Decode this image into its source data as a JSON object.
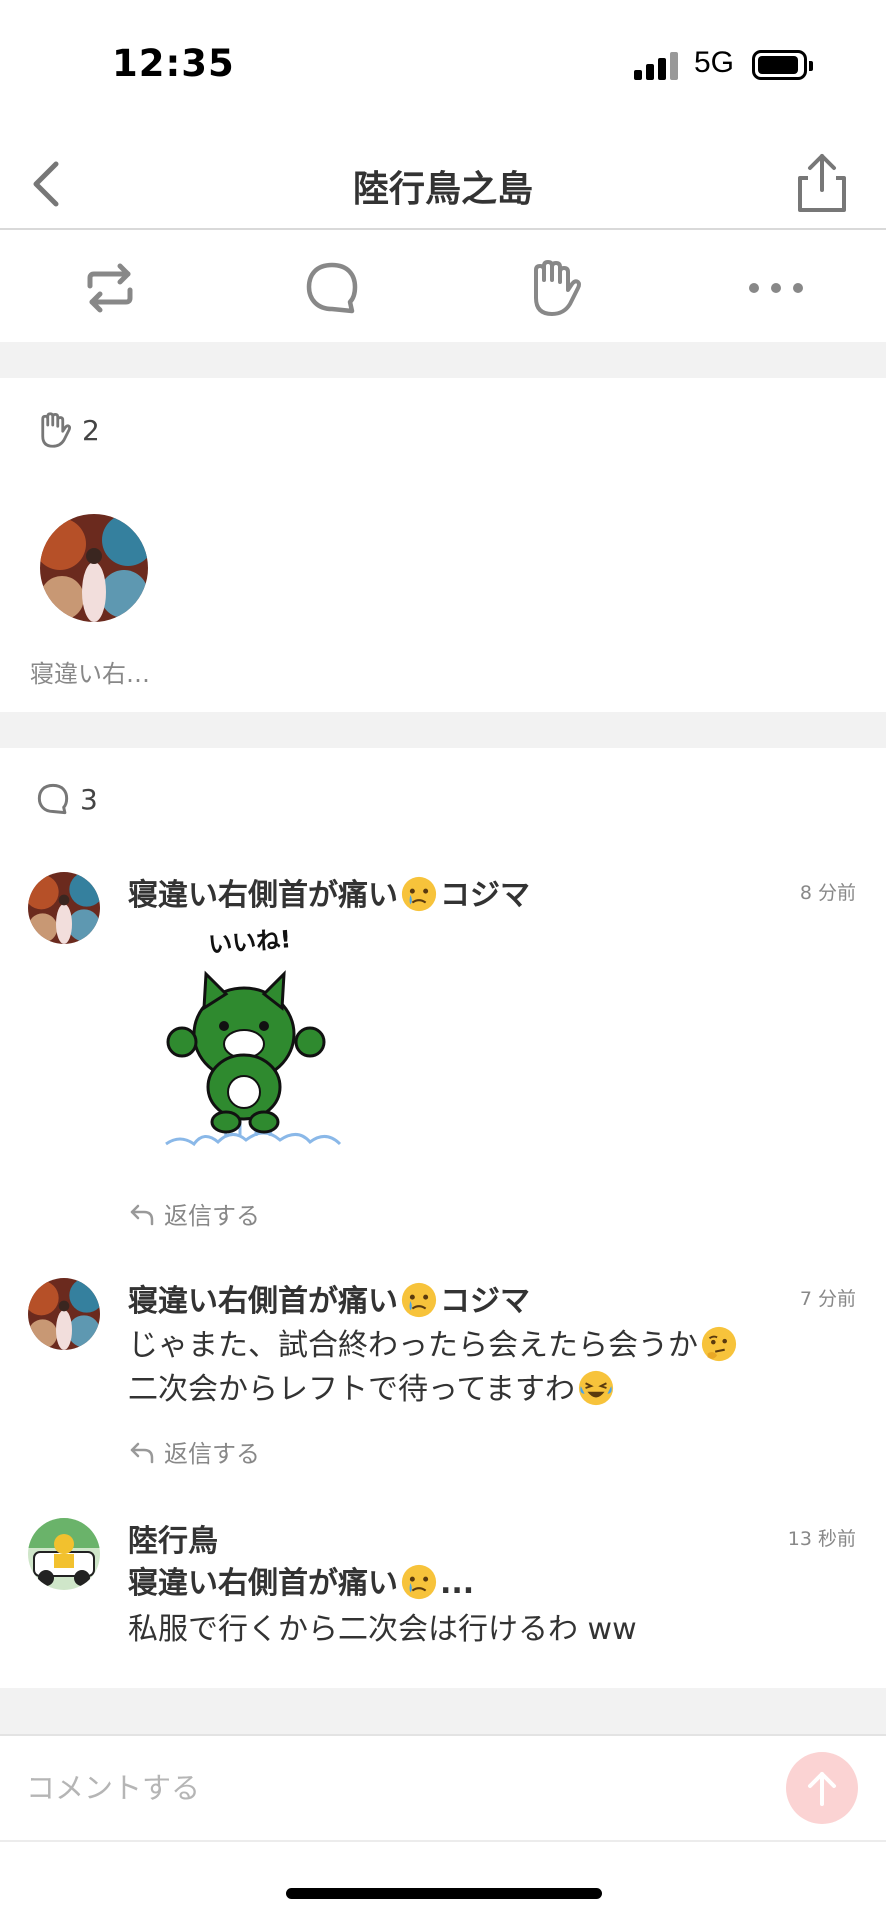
{
  "status_bar": {
    "time": "12:35",
    "network": "5G"
  },
  "nav": {
    "title": "陸行鳥之島",
    "back_icon": "chevron-left-icon",
    "share_icon": "share-icon"
  },
  "actions": [
    {
      "name": "repost",
      "icon": "repost-icon"
    },
    {
      "name": "comment",
      "icon": "comment-bubble-icon"
    },
    {
      "name": "clap",
      "icon": "clap-hand-icon"
    },
    {
      "name": "more",
      "icon": "more-dots-icon"
    }
  ],
  "likes": {
    "count": "2",
    "users": [
      {
        "name": "寝違い右…"
      }
    ]
  },
  "comments_section": {
    "count": "3",
    "comments": [
      {
        "author_pre": "寝違い右側首が痛い",
        "author_post": "コジマ",
        "time": "8 分前",
        "sticker_text": "いいね!",
        "reply_label": "返信する"
      },
      {
        "author_pre": "寝違い右側首が痛い",
        "author_post": "コジマ",
        "time": "7 分前",
        "line1": "じゃまた、試合終わったら会えたら会うか",
        "line2": "二次会からレフトで待ってますわ",
        "reply_label": "返信する"
      },
      {
        "author": "陸行鳥",
        "time": "13 秒前",
        "mention_pre": "寝違い右側首が痛い",
        "mention_post": "...",
        "text": "私服で行くから二次会は行けるわ ww"
      }
    ]
  },
  "input": {
    "placeholder": "コメントする"
  },
  "colors": {
    "accent_soft": "#fbd3d3",
    "divider": "#f2f2f2",
    "sticker_green": "#2f8a2f"
  }
}
